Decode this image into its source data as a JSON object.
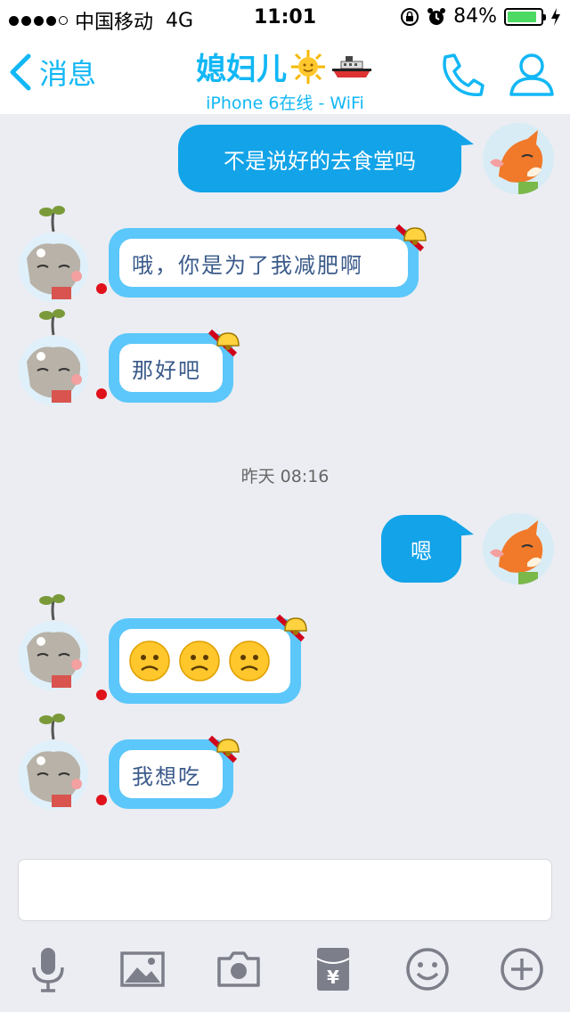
{
  "status_bar": {
    "carrier": "中国移动",
    "network": "4G",
    "time": "11:01",
    "battery": "84%"
  },
  "nav": {
    "back_label": "消息",
    "title": "媳妇儿",
    "subtitle": "iPhone 6在线 - WiFi"
  },
  "messages": {
    "m1": "不是说好的去食堂吗",
    "m2": "哦，你是为了我减肥啊",
    "m3": "那好吧",
    "timestamp": "昨天 08:16",
    "m4": "嗯",
    "m6": "我想吃"
  },
  "colors": {
    "accent": "#12b7f5",
    "bubble_out": "#12a3e8",
    "bubble_in_border": "#5cc7fa"
  },
  "icons": [
    "back-chevron-icon",
    "phone-icon",
    "profile-icon",
    "microphone-icon",
    "image-icon",
    "camera-icon",
    "red-packet-icon",
    "emoji-icon",
    "plus-icon"
  ]
}
